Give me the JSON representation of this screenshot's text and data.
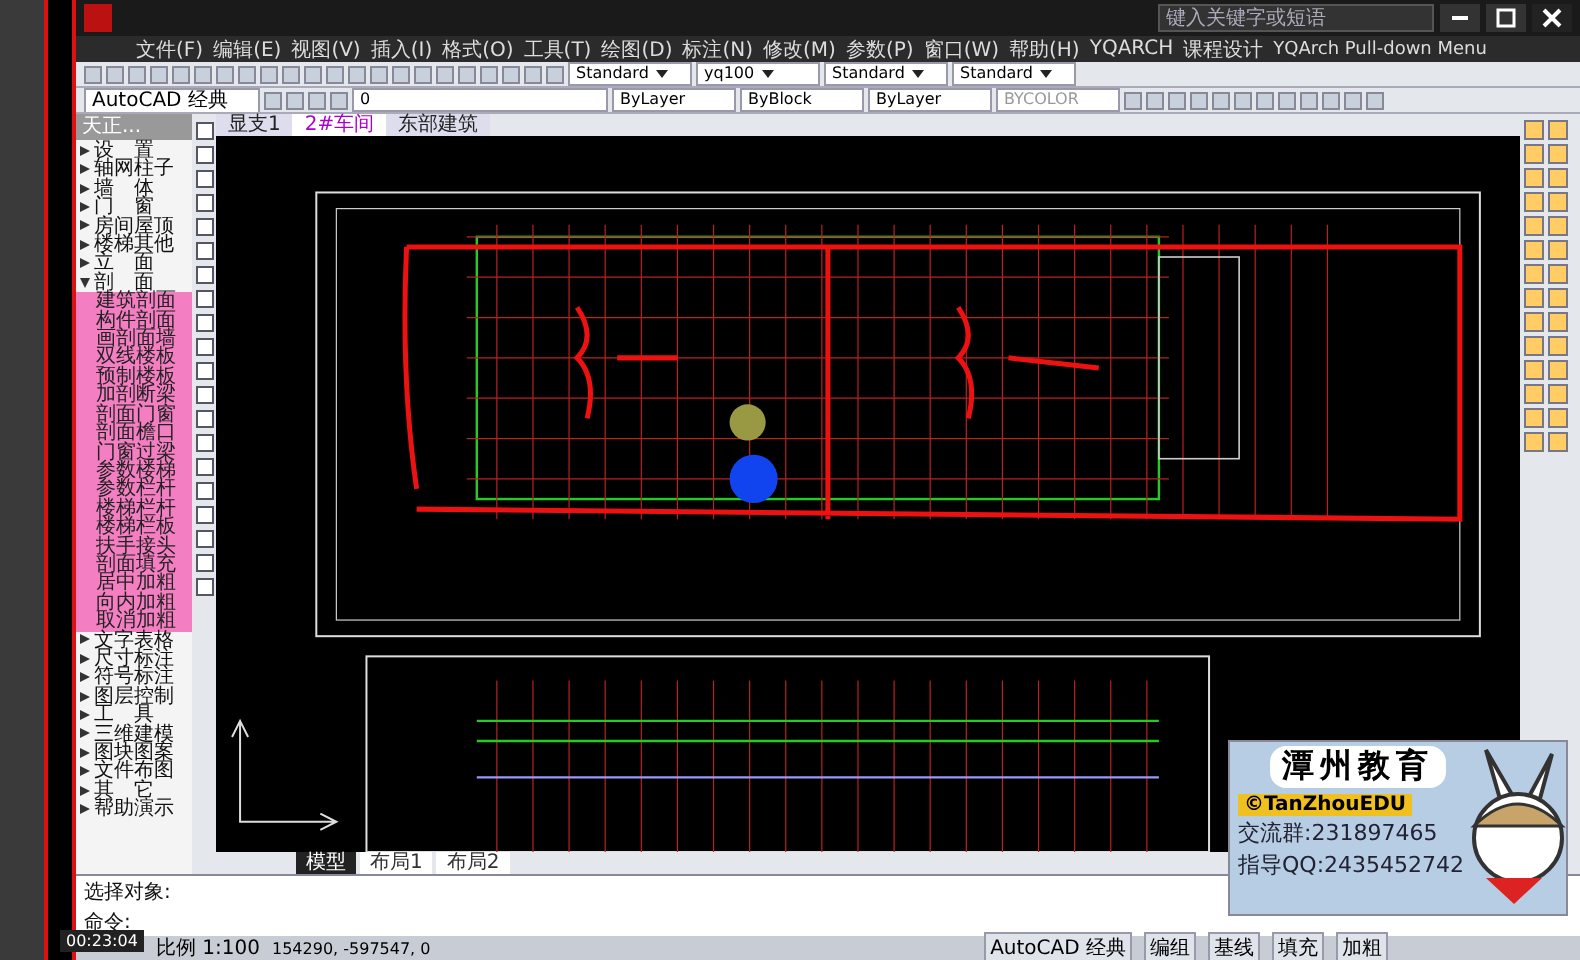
{
  "search": {
    "placeholder": "键入关键字或短语"
  },
  "menu": [
    "文件(F)",
    "编辑(E)",
    "视图(V)",
    "插入(I)",
    "格式(O)",
    "工具(T)",
    "绘图(D)",
    "标注(N)",
    "修改(M)",
    "参数(P)",
    "窗口(W)",
    "帮助(H)",
    "YQARCH",
    "课程设计",
    "YQArch Pull-down Menu"
  ],
  "styles_toolbar": [
    "Standard",
    "yq100",
    "Standard",
    "Standard"
  ],
  "properties_toolbar": {
    "workspace": "AutoCAD 经典",
    "layer": "0",
    "color_control": "ByLayer",
    "linetype": "ByBlock",
    "lineweight": "ByLayer",
    "plotstyle": "BYCOLOR"
  },
  "doc_tabs": [
    {
      "label": "显支1",
      "selected": false
    },
    {
      "label": "2#车间",
      "selected": true
    },
    {
      "label": "东部建筑",
      "selected": false
    }
  ],
  "sidebar": {
    "title": "天正...",
    "items": [
      {
        "label": "设　置",
        "expanded": false
      },
      {
        "label": "轴网柱子",
        "expanded": false
      },
      {
        "label": "墙　体",
        "expanded": false
      },
      {
        "label": "门　窗",
        "expanded": false
      },
      {
        "label": "房间屋顶",
        "expanded": false
      },
      {
        "label": "楼梯其他",
        "expanded": false
      },
      {
        "label": "立　面",
        "expanded": false
      },
      {
        "label": "剖　面",
        "expanded": true,
        "children": [
          "建筑剖面",
          "构件剖面",
          "画剖面墙",
          "双线楼板",
          "预制楼板",
          "加剖断梁",
          "剖面门窗",
          "剖面檐口",
          "门窗过梁",
          "参数楼梯",
          "参数栏杆",
          "楼梯栏杆",
          "楼梯栏板",
          "扶手接头",
          "剖面填充",
          "居中加粗",
          "向内加粗",
          "取消加粗"
        ]
      },
      {
        "label": "文字表格",
        "expanded": false
      },
      {
        "label": "尺寸标注",
        "expanded": false
      },
      {
        "label": "符号标注",
        "expanded": false
      },
      {
        "label": "图层控制",
        "expanded": false
      },
      {
        "label": "工　具",
        "expanded": false
      },
      {
        "label": "三维建模",
        "expanded": false
      },
      {
        "label": "图块图案",
        "expanded": false
      },
      {
        "label": "文件布图",
        "expanded": false
      },
      {
        "label": "其　它",
        "expanded": false
      },
      {
        "label": "帮助演示",
        "expanded": false
      }
    ]
  },
  "layout_tabs": [
    {
      "label": "模型",
      "selected": true
    },
    {
      "label": "布局1",
      "selected": false
    },
    {
      "label": "布局2",
      "selected": false
    }
  ],
  "command_lines": [
    "选择对象:",
    "命令:"
  ],
  "status_bar": {
    "scale": "比例 1:100",
    "coordinates": "154290, -597547, 0",
    "workspace": "AutoCAD 经典",
    "toggles": [
      "编组",
      "基线",
      "填充",
      "加粗"
    ]
  },
  "player": {
    "time": "00:23:04"
  },
  "badge": {
    "title": "潭州教育",
    "brand": "©TanZhouEDU",
    "group": "交流群:231897465",
    "qq": "指导QQ:2435452742"
  }
}
